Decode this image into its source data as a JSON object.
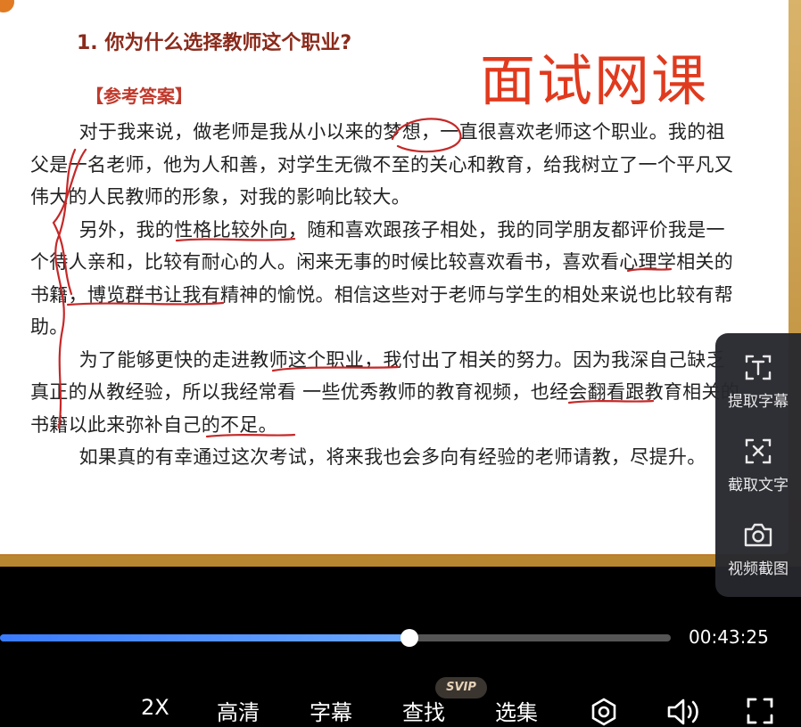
{
  "slide": {
    "question": "1. 你为什么选择教师这个职业?",
    "watermark": "面试网课",
    "answer_label": "【参考答案】",
    "paragraphs": [
      "对于我来说，做老师是我从小以来的梦想，一直很喜欢老师这个职业。我的祖父是一名老师，他为人和善，对学生无微不至的关心和教育，给我树立了一个平凡又伟大的人民教师的形象，对我的影响比较大。",
      "另外，我的性格比较外向，随和喜欢跟孩子相处，我的同学朋友都评价我是一个待人亲和，比较有耐心的人。闲来无事的时候比较喜欢看书，喜欢看心理学相关的书籍，博览群书让我有精神的愉悦。相信这些对于老师与学生的相处来说也比较有帮助。",
      "为了能够更快的走进教师这个职业，我付出了相关的努力。因为我深自己缺乏真正的从教经验，所以我经常看 一些优秀教师的教育视频，也经会翻看跟教育相关的书籍以此来弥补自己的不足。",
      "如果真的有幸通过这次考试，将来我也会多向有经验的老师请教，尽提升。"
    ]
  },
  "sidebar": {
    "items": [
      {
        "label": "提取字幕",
        "icon": "extract-subtitle-icon"
      },
      {
        "label": "截取文字",
        "icon": "capture-text-icon"
      },
      {
        "label": "视频截图",
        "icon": "camera-icon"
      }
    ]
  },
  "player": {
    "progress_fraction": 0.61,
    "time": "00:43:25",
    "badge": "SVIP",
    "controls": {
      "speed": "2X",
      "quality": "高清",
      "subtitles": "字幕",
      "search": "查找",
      "episodes": "选集"
    }
  },
  "colors": {
    "question": "#8b2a1b",
    "watermark": "#e03a1e",
    "answer_label": "#c0392b",
    "progress_accent": "#3a7bff",
    "annotation_ink": "#c62828"
  }
}
